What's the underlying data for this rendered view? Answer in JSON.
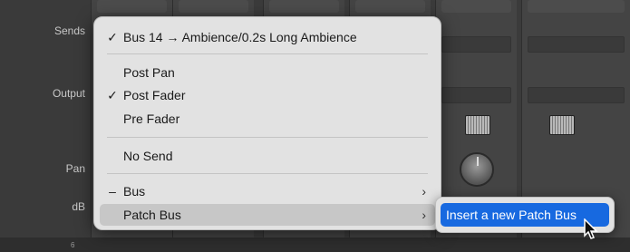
{
  "mixer": {
    "row_labels": {
      "sends": "Sends",
      "output": "Output",
      "pan": "Pan",
      "db": "dB"
    },
    "scale_tick": "6"
  },
  "menu": {
    "items": [
      {
        "label": "Bus 14 → Ambience/0.2s Long Ambience",
        "mark": "✓",
        "submenu": false
      },
      {
        "label": "Post Pan",
        "mark": "",
        "submenu": false
      },
      {
        "label": "Post Fader",
        "mark": "✓",
        "submenu": false
      },
      {
        "label": "Pre Fader",
        "mark": "",
        "submenu": false
      },
      {
        "label": "No Send",
        "mark": "",
        "submenu": false
      },
      {
        "label": "Bus",
        "mark": "–",
        "submenu": true
      },
      {
        "label": "Patch Bus",
        "mark": "",
        "submenu": true,
        "highlighted": true
      }
    ],
    "chevron": "›"
  },
  "submenu": {
    "items": [
      {
        "label": "Insert a new Patch Bus",
        "highlighted": true
      }
    ]
  },
  "colors": {
    "menu_bg": "#e2e2e2",
    "highlight": "#1769e0",
    "hover": "#c7c7c7"
  },
  "icons": {
    "cursor": "pointer-arrow-icon",
    "knob": "pan-knob-icon",
    "plugin": "plugin-thumbnail-icon"
  }
}
